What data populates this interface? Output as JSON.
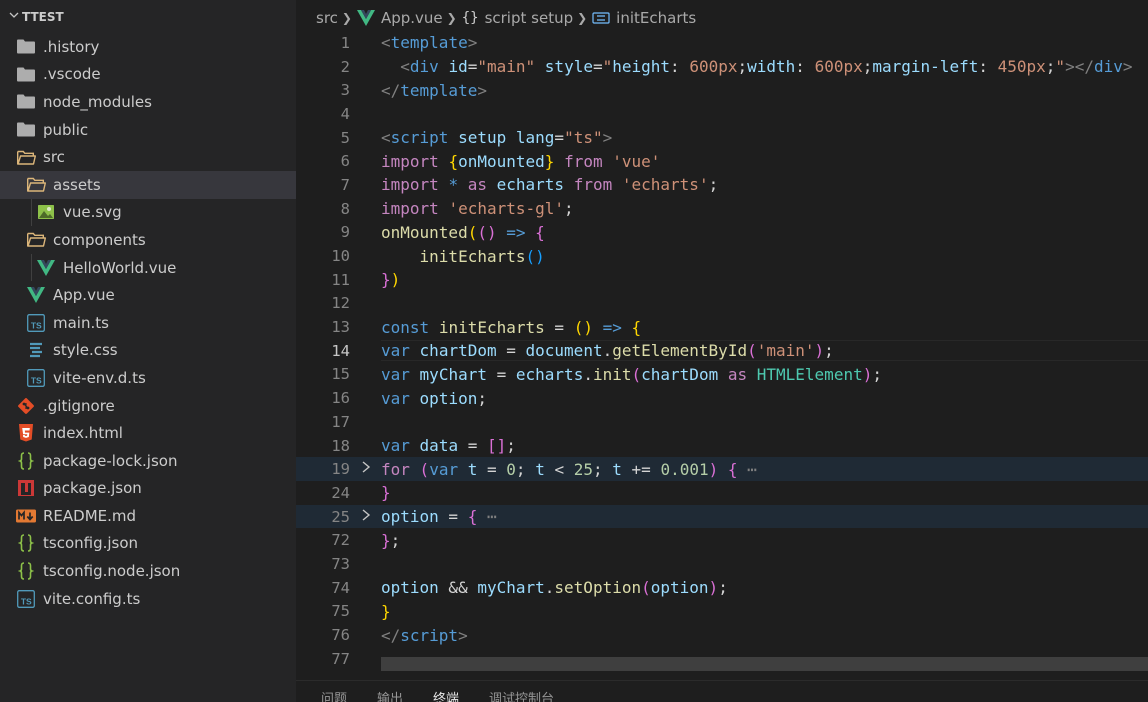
{
  "explorer": {
    "title": "TTEST",
    "items": [
      {
        "label": ".history",
        "icon": "folder-icon",
        "depth": 0
      },
      {
        "label": ".vscode",
        "icon": "folder-icon",
        "depth": 0
      },
      {
        "label": "node_modules",
        "icon": "folder-icon",
        "depth": 0
      },
      {
        "label": "public",
        "icon": "folder-icon",
        "depth": 0
      },
      {
        "label": "src",
        "icon": "folder-open-icon",
        "depth": 0
      },
      {
        "label": "assets",
        "icon": "folder-open-icon",
        "depth": 1
      },
      {
        "label": "vue.svg",
        "icon": "image-file-icon",
        "depth": 2
      },
      {
        "label": "components",
        "icon": "folder-open-icon",
        "depth": 1
      },
      {
        "label": "HelloWorld.vue",
        "icon": "vue-file-icon",
        "depth": 2
      },
      {
        "label": "App.vue",
        "icon": "vue-file-icon",
        "depth": 1
      },
      {
        "label": "main.ts",
        "icon": "ts-file-icon",
        "depth": 1
      },
      {
        "label": "style.css",
        "icon": "css-file-icon",
        "depth": 1
      },
      {
        "label": "vite-env.d.ts",
        "icon": "ts-file-icon",
        "depth": 1
      },
      {
        "label": ".gitignore",
        "icon": "git-file-icon",
        "depth": 0
      },
      {
        "label": "index.html",
        "icon": "html-file-icon",
        "depth": 0
      },
      {
        "label": "package-lock.json",
        "icon": "json-file-icon",
        "depth": 0
      },
      {
        "label": "package.json",
        "icon": "npm-file-icon",
        "depth": 0
      },
      {
        "label": "README.md",
        "icon": "markdown-file-icon",
        "depth": 0
      },
      {
        "label": "tsconfig.json",
        "icon": "json-file-icon",
        "depth": 0
      },
      {
        "label": "tsconfig.node.json",
        "icon": "json-file-icon",
        "depth": 0
      },
      {
        "label": "vite.config.ts",
        "icon": "ts-file-icon",
        "depth": 0
      }
    ]
  },
  "breadcrumb": {
    "folder": "src",
    "file": "App.vue",
    "section": "script setup",
    "symbol": "initEcharts"
  },
  "editor": {
    "lines": [
      {
        "n": "1",
        "fold": "",
        "tokens": [
          [
            "t-punc-tag",
            "<"
          ],
          [
            "t-tag",
            "template"
          ],
          [
            "t-punc-tag",
            ">"
          ]
        ]
      },
      {
        "n": "2",
        "fold": "",
        "tokens": [
          [
            "t-def",
            "  "
          ],
          [
            "t-punc-tag",
            "<"
          ],
          [
            "t-tag",
            "div"
          ],
          [
            "t-def",
            " "
          ],
          [
            "t-attr",
            "id"
          ],
          [
            "t-def",
            "="
          ],
          [
            "t-str",
            "\"main\""
          ],
          [
            "t-def",
            " "
          ],
          [
            "t-attr",
            "style"
          ],
          [
            "t-def",
            "="
          ],
          [
            "t-str",
            "\""
          ],
          [
            "t-attr",
            "height"
          ],
          [
            "t-def",
            ": "
          ],
          [
            "t-str",
            "600px"
          ],
          [
            "t-def",
            ";"
          ],
          [
            "t-attr",
            "width"
          ],
          [
            "t-def",
            ": "
          ],
          [
            "t-str",
            "600px"
          ],
          [
            "t-def",
            ";"
          ],
          [
            "t-attr",
            "margin-left"
          ],
          [
            "t-def",
            ": "
          ],
          [
            "t-str",
            "450px"
          ],
          [
            "t-def",
            ";"
          ],
          [
            "t-str",
            "\""
          ],
          [
            "t-punc-tag",
            "></"
          ],
          [
            "t-tag",
            "div"
          ],
          [
            "t-punc-tag",
            ">"
          ]
        ]
      },
      {
        "n": "3",
        "fold": "",
        "tokens": [
          [
            "t-punc-tag",
            "</"
          ],
          [
            "t-tag",
            "template"
          ],
          [
            "t-punc-tag",
            ">"
          ]
        ]
      },
      {
        "n": "4",
        "fold": "",
        "tokens": []
      },
      {
        "n": "5",
        "fold": "",
        "tokens": [
          [
            "t-punc-tag",
            "<"
          ],
          [
            "t-tag",
            "script"
          ],
          [
            "t-def",
            " "
          ],
          [
            "t-attr",
            "setup"
          ],
          [
            "t-def",
            " "
          ],
          [
            "t-attr",
            "lang"
          ],
          [
            "t-def",
            "="
          ],
          [
            "t-str",
            "\"ts\""
          ],
          [
            "t-punc-tag",
            ">"
          ]
        ]
      },
      {
        "n": "6",
        "fold": "",
        "tokens": [
          [
            "t-ctrl",
            "import"
          ],
          [
            "t-def",
            " "
          ],
          [
            "t-br1",
            "{"
          ],
          [
            "t-var",
            "onMounted"
          ],
          [
            "t-br1",
            "}"
          ],
          [
            "t-def",
            " "
          ],
          [
            "t-ctrl",
            "from"
          ],
          [
            "t-def",
            " "
          ],
          [
            "t-str",
            "'vue'"
          ]
        ]
      },
      {
        "n": "7",
        "fold": "",
        "tokens": [
          [
            "t-ctrl",
            "import"
          ],
          [
            "t-def",
            " "
          ],
          [
            "t-kw",
            "*"
          ],
          [
            "t-def",
            " "
          ],
          [
            "t-ctrl",
            "as"
          ],
          [
            "t-def",
            " "
          ],
          [
            "t-var",
            "echarts"
          ],
          [
            "t-def",
            " "
          ],
          [
            "t-ctrl",
            "from"
          ],
          [
            "t-def",
            " "
          ],
          [
            "t-str",
            "'echarts'"
          ],
          [
            "t-def",
            ";"
          ]
        ]
      },
      {
        "n": "8",
        "fold": "",
        "tokens": [
          [
            "t-ctrl",
            "import"
          ],
          [
            "t-def",
            " "
          ],
          [
            "t-str",
            "'echarts-gl'"
          ],
          [
            "t-def",
            ";"
          ]
        ]
      },
      {
        "n": "9",
        "fold": "",
        "tokens": [
          [
            "t-fn",
            "onMounted"
          ],
          [
            "t-br1",
            "("
          ],
          [
            "t-br2",
            "()"
          ],
          [
            "t-def",
            " "
          ],
          [
            "t-kw",
            "=>"
          ],
          [
            "t-def",
            " "
          ],
          [
            "t-br2",
            "{"
          ]
        ]
      },
      {
        "n": "10",
        "fold": "",
        "tokens": [
          [
            "t-def",
            "    "
          ],
          [
            "t-fn",
            "initEcharts"
          ],
          [
            "t-br3",
            "()"
          ]
        ]
      },
      {
        "n": "11",
        "fold": "",
        "tokens": [
          [
            "t-br2",
            "}"
          ],
          [
            "t-br1",
            ")"
          ]
        ]
      },
      {
        "n": "12",
        "fold": "",
        "tokens": []
      },
      {
        "n": "13",
        "fold": "",
        "tokens": [
          [
            "t-kw",
            "const"
          ],
          [
            "t-def",
            " "
          ],
          [
            "t-fn",
            "initEcharts"
          ],
          [
            "t-def",
            " = "
          ],
          [
            "t-br1",
            "()"
          ],
          [
            "t-def",
            " "
          ],
          [
            "t-kw",
            "=>"
          ],
          [
            "t-def",
            " "
          ],
          [
            "t-br1",
            "{"
          ]
        ]
      },
      {
        "n": "14",
        "fold": "",
        "tokens": [
          [
            "t-kw",
            "var"
          ],
          [
            "t-def",
            " "
          ],
          [
            "t-var",
            "chartDom"
          ],
          [
            "t-def",
            " = "
          ],
          [
            "t-var",
            "document"
          ],
          [
            "t-def",
            "."
          ],
          [
            "t-fn",
            "getElementById"
          ],
          [
            "t-br2",
            "("
          ],
          [
            "t-str",
            "'main'"
          ],
          [
            "t-br2",
            ")"
          ],
          [
            "t-def",
            ";"
          ]
        ]
      },
      {
        "n": "15",
        "fold": "",
        "tokens": [
          [
            "t-kw",
            "var"
          ],
          [
            "t-def",
            " "
          ],
          [
            "t-var",
            "myChart"
          ],
          [
            "t-def",
            " = "
          ],
          [
            "t-var",
            "echarts"
          ],
          [
            "t-def",
            "."
          ],
          [
            "t-fn",
            "init"
          ],
          [
            "t-br2",
            "("
          ],
          [
            "t-var",
            "chartDom"
          ],
          [
            "t-def",
            " "
          ],
          [
            "t-ctrl",
            "as"
          ],
          [
            "t-def",
            " "
          ],
          [
            "t-type",
            "HTMLElement"
          ],
          [
            "t-br2",
            ")"
          ],
          [
            "t-def",
            ";"
          ]
        ]
      },
      {
        "n": "16",
        "fold": "",
        "tokens": [
          [
            "t-kw",
            "var"
          ],
          [
            "t-def",
            " "
          ],
          [
            "t-var",
            "option"
          ],
          [
            "t-def",
            ";"
          ]
        ]
      },
      {
        "n": "17",
        "fold": "",
        "tokens": []
      },
      {
        "n": "18",
        "fold": "",
        "tokens": [
          [
            "t-kw",
            "var"
          ],
          [
            "t-def",
            " "
          ],
          [
            "t-var",
            "data"
          ],
          [
            "t-def",
            " = "
          ],
          [
            "t-br2",
            "[]"
          ],
          [
            "t-def",
            ";"
          ]
        ]
      },
      {
        "n": "19",
        "fold": ">",
        "tokens": [
          [
            "t-ctrl",
            "for"
          ],
          [
            "t-def",
            " "
          ],
          [
            "t-br2",
            "("
          ],
          [
            "t-kw",
            "var"
          ],
          [
            "t-def",
            " "
          ],
          [
            "t-var",
            "t"
          ],
          [
            "t-def",
            " = "
          ],
          [
            "t-num",
            "0"
          ],
          [
            "t-def",
            "; "
          ],
          [
            "t-var",
            "t"
          ],
          [
            "t-def",
            " < "
          ],
          [
            "t-num",
            "25"
          ],
          [
            "t-def",
            "; "
          ],
          [
            "t-var",
            "t"
          ],
          [
            "t-def",
            " += "
          ],
          [
            "t-num",
            "0.001"
          ],
          [
            "t-br2",
            ")"
          ],
          [
            "t-def",
            " "
          ],
          [
            "t-br2",
            "{"
          ],
          [
            "t-ellip",
            " ⋯"
          ]
        ]
      },
      {
        "n": "24",
        "fold": "",
        "tokens": [
          [
            "t-br2",
            "}"
          ]
        ]
      },
      {
        "n": "25",
        "fold": ">",
        "tokens": [
          [
            "t-var",
            "option"
          ],
          [
            "t-def",
            " = "
          ],
          [
            "t-br2",
            "{"
          ],
          [
            "t-ellip",
            " ⋯"
          ]
        ]
      },
      {
        "n": "72",
        "fold": "",
        "tokens": [
          [
            "t-br2",
            "}"
          ],
          [
            "t-def",
            ";"
          ]
        ]
      },
      {
        "n": "73",
        "fold": "",
        "tokens": []
      },
      {
        "n": "74",
        "fold": "",
        "tokens": [
          [
            "t-var",
            "option"
          ],
          [
            "t-def",
            " && "
          ],
          [
            "t-var",
            "myChart"
          ],
          [
            "t-def",
            "."
          ],
          [
            "t-fn",
            "setOption"
          ],
          [
            "t-br2",
            "("
          ],
          [
            "t-var",
            "option"
          ],
          [
            "t-br2",
            ")"
          ],
          [
            "t-def",
            ";"
          ]
        ]
      },
      {
        "n": "75",
        "fold": "",
        "tokens": [
          [
            "t-br1",
            "}"
          ]
        ]
      },
      {
        "n": "76",
        "fold": "",
        "tokens": [
          [
            "t-punc-tag",
            "</"
          ],
          [
            "t-tag",
            "script"
          ],
          [
            "t-punc-tag",
            ">"
          ]
        ]
      },
      {
        "n": "77",
        "fold": "",
        "tokens": []
      }
    ],
    "active_line": "14"
  },
  "panel": {
    "tabs": [
      "问题",
      "输出",
      "终端",
      "调试控制台"
    ],
    "active_tab": "终端"
  }
}
